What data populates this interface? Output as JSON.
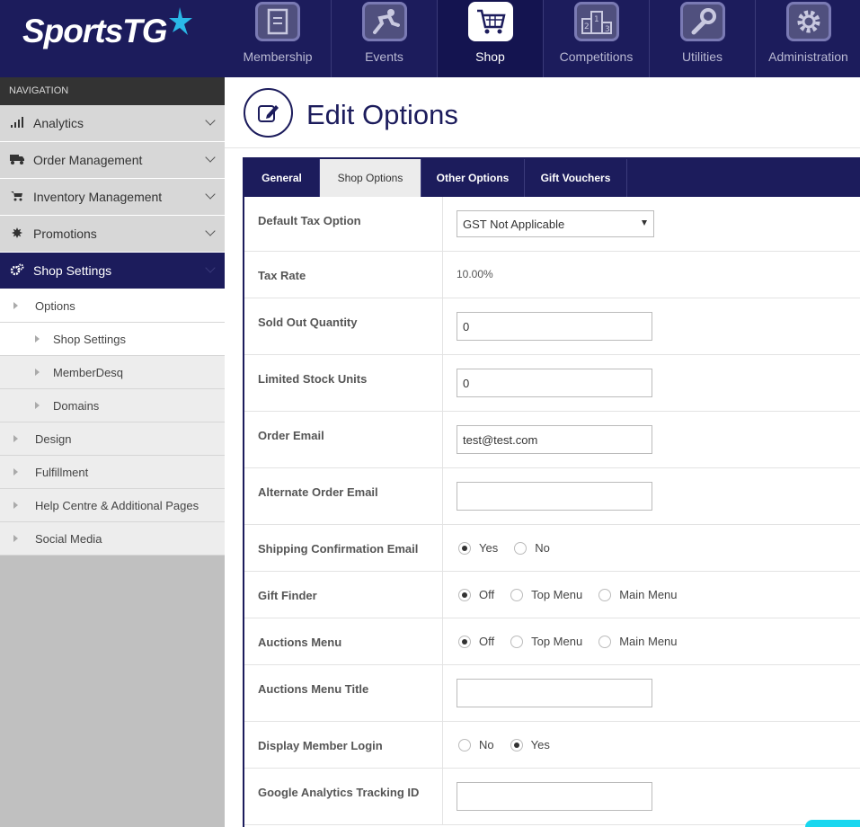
{
  "brand": {
    "name": "SportsTG"
  },
  "top_nav": [
    {
      "label": "Membership",
      "icon": "membership-icon",
      "active": false
    },
    {
      "label": "Events",
      "icon": "events-icon",
      "active": false
    },
    {
      "label": "Shop",
      "icon": "shop-cart-icon",
      "active": true
    },
    {
      "label": "Competitions",
      "icon": "competitions-podium-icon",
      "active": false
    },
    {
      "label": "Utilities",
      "icon": "utilities-wrench-icon",
      "active": false
    },
    {
      "label": "Administration",
      "icon": "administration-gear-icon",
      "active": false
    }
  ],
  "sidebar": {
    "heading": "NAVIGATION",
    "items": [
      {
        "label": "Analytics",
        "icon": "bar-chart-icon"
      },
      {
        "label": "Order Management",
        "icon": "truck-icon"
      },
      {
        "label": "Inventory Management",
        "icon": "cart-icon"
      },
      {
        "label": "Promotions",
        "icon": "burst-icon"
      },
      {
        "label": "Shop Settings",
        "icon": "cogs-icon"
      }
    ],
    "sub_items": [
      {
        "label": "Options"
      },
      {
        "label": "Shop Settings"
      },
      {
        "label": "MemberDesq"
      },
      {
        "label": "Domains"
      },
      {
        "label": "Design"
      },
      {
        "label": "Fulfillment"
      },
      {
        "label": "Help Centre & Additional Pages"
      },
      {
        "label": "Social Media"
      }
    ]
  },
  "page": {
    "title": "Edit Options"
  },
  "tabs": [
    {
      "label": "General"
    },
    {
      "label": "Shop Options"
    },
    {
      "label": "Other Options"
    },
    {
      "label": "Gift Vouchers"
    }
  ],
  "form": {
    "default_tax": {
      "label": "Default Tax Option",
      "value": "GST Not Applicable"
    },
    "tax_rate": {
      "label": "Tax Rate",
      "value": "10.00%"
    },
    "sold_out_qty": {
      "label": "Sold Out Quantity",
      "value": "0"
    },
    "limited_stock": {
      "label": "Limited Stock Units",
      "value": "0"
    },
    "order_email": {
      "label": "Order Email",
      "value": "test@test.com"
    },
    "alt_order_email": {
      "label": "Alternate Order Email",
      "value": ""
    },
    "shipping_confirm": {
      "label": "Shipping Confirmation Email",
      "options": [
        "Yes",
        "No"
      ],
      "selected": "Yes"
    },
    "gift_finder": {
      "label": "Gift Finder",
      "options": [
        "Off",
        "Top Menu",
        "Main Menu"
      ],
      "selected": "Off"
    },
    "auctions_menu": {
      "label": "Auctions Menu",
      "options": [
        "Off",
        "Top Menu",
        "Main Menu"
      ],
      "selected": "Off"
    },
    "auctions_title": {
      "label": "Auctions Menu Title",
      "value": ""
    },
    "member_login": {
      "label": "Display Member Login",
      "options": [
        "No",
        "Yes"
      ],
      "selected": "Yes"
    },
    "ga_tracking": {
      "label": "Google Analytics Tracking ID",
      "value": ""
    }
  },
  "colors": {
    "navy": "#1c1c5c",
    "accent": "#19d7ef",
    "star": "#2ab8e8"
  }
}
